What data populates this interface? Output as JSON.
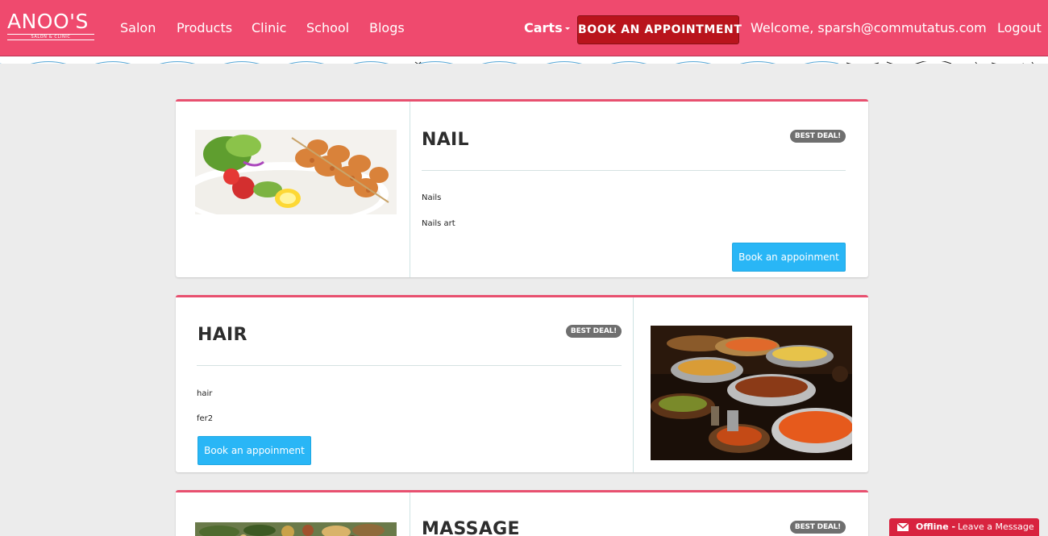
{
  "header": {
    "logo": "ANOO'S",
    "logo_sub": "SALON & CLINIC",
    "nav": [
      "Salon",
      "Products",
      "Clinic",
      "School",
      "Blogs"
    ],
    "carts": "Carts",
    "book_button": "BOOK AN APPOINTMENT",
    "welcome": "Welcome, sparsh@commutatus.com",
    "logout": "Logout"
  },
  "cards": [
    {
      "title": "NAIL",
      "badge": "BEST DEAL!",
      "lines": [
        "Nails",
        "Nails art"
      ],
      "button": "Book an appoinment",
      "image": "grilled-chicken-salad"
    },
    {
      "title": "HAIR",
      "badge": "BEST DEAL!",
      "lines": [
        "hair",
        "fer2"
      ],
      "button": "Book an appoinment",
      "image": "buffet-curries"
    },
    {
      "title": "MASSAGE",
      "badge": "BEST DEAL!",
      "image": "spices-herbs"
    }
  ],
  "chat": {
    "status": "Offline -",
    "message": "Leave a Message"
  },
  "colors": {
    "brand": "#ef4a6e",
    "book_button": "#b9141c",
    "card_accent": "#e8506f",
    "action_button": "#29b6f6",
    "chat_tab": "#d8233f"
  }
}
